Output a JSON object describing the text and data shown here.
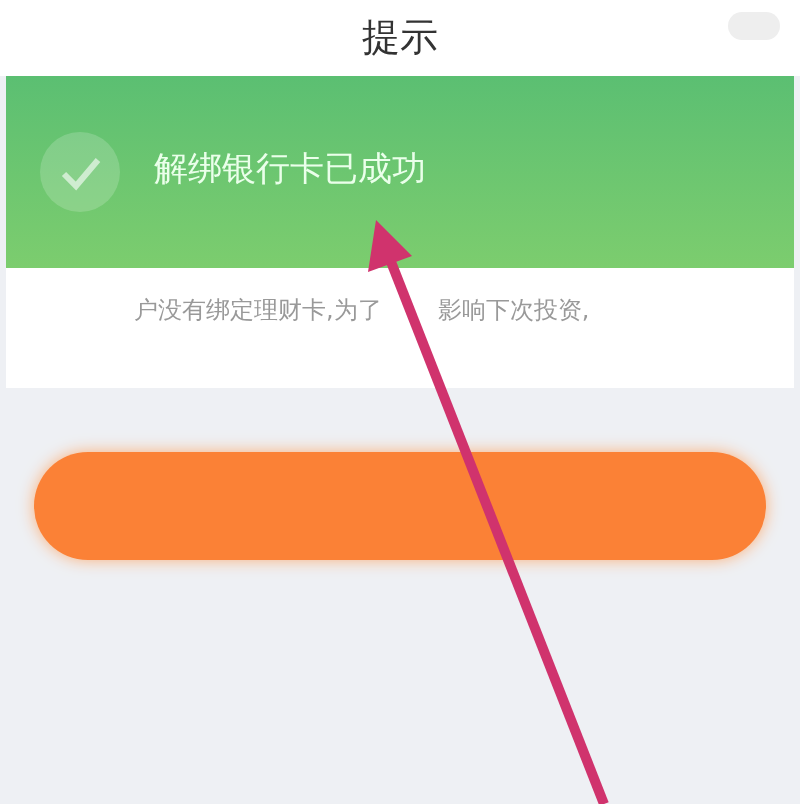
{
  "header": {
    "title": "提示"
  },
  "banner": {
    "message": "解绑银行卡已成功"
  },
  "notice": {
    "parts": [
      "户没有绑定理财卡,为了",
      "影响下次投资,"
    ]
  }
}
